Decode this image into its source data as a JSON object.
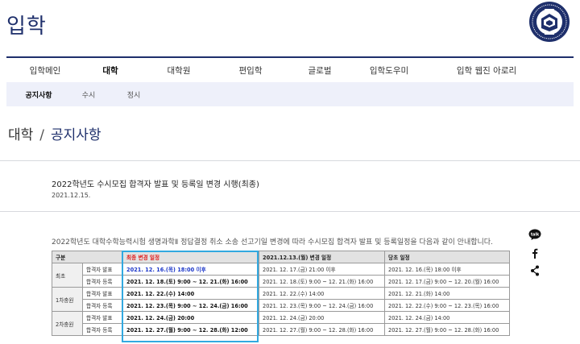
{
  "header": {
    "site_title": "입학",
    "logo_icon": "snu-emblem-icon"
  },
  "gnb": {
    "items": [
      "입학메인",
      "대학",
      "대학원",
      "편입학",
      "글로벌",
      "입학도우미",
      "입학 웹진 아로리"
    ],
    "active_index": 1
  },
  "lnb": {
    "items": [
      "공지사항",
      "수시",
      "정시"
    ],
    "active_index": 0
  },
  "breadcrumb": {
    "parent": "대학",
    "separator": "/",
    "current": "공지사항"
  },
  "post": {
    "title": "2022학년도 수시모집 합격자 발표 및 등록일 변경 시행(최종)",
    "date": "2021.12.15."
  },
  "intro": "2022학년도 대학수학능력시험 생명과학Ⅱ 정답결정 취소 소송 선고기일 변경에 따라 수시모집 합격자 발표 및 등록일정을 다음과 같이 안내합니다.",
  "share": {
    "icons": [
      "talk-icon",
      "facebook-icon",
      "share-icon"
    ],
    "talk_label": "talk"
  },
  "table": {
    "headers": [
      "구분",
      "최종 변경 일정",
      "2021.12.13.(월) 변경 일정",
      "당초 일정"
    ],
    "groups": [
      {
        "label": "최초",
        "rows": [
          {
            "sub": "합격자 발표",
            "final": "2021. 12. 16.(목) 18:00 이후",
            "mid": "2021. 12. 17.(금) 21:00 이후",
            "orig": "2021. 12. 16.(목) 18:00 이후"
          },
          {
            "sub": "합격자 등록",
            "final": "2021. 12. 18.(토) 9:00 ~ 12. 21.(화) 16:00",
            "mid": "2021. 12. 18.(토) 9:00 ~ 12. 21.(화) 16:00",
            "orig": "2021. 12. 17.(금) 9:00 ~ 12. 20.(월) 16:00"
          }
        ]
      },
      {
        "label": "1차충원",
        "rows": [
          {
            "sub": "합격자 발표",
            "final": "2021. 12. 22.(수) 14:00",
            "mid": "2021. 12. 22.(수) 14:00",
            "orig": "2021. 12. 21.(화) 14:00"
          },
          {
            "sub": "합격자 등록",
            "final": "2021. 12. 23.(목) 9:00 ~ 12. 24.(금) 16:00",
            "mid": "2021. 12. 23.(목) 9:00 ~ 12. 24.(금) 16:00",
            "orig": "2021. 12. 22.(수) 9:00 ~ 12. 23.(목) 16:00"
          }
        ]
      },
      {
        "label": "2차충원",
        "rows": [
          {
            "sub": "합격자 발표",
            "final": "2021. 12. 24.(금) 20:00",
            "mid": "2021. 12. 24.(금) 20:00",
            "orig": "2021. 12. 24.(금) 14:00"
          },
          {
            "sub": "합격자 등록",
            "final": "2021. 12. 27.(월) 9:00 ~ 12. 28.(화) 12:00",
            "mid": "2021. 12. 27.(월) 9:00 ~ 12. 28.(화) 16:00",
            "orig": "2021. 12. 27.(월) 9:00 ~ 12. 28.(화) 16:00"
          }
        ]
      }
    ]
  },
  "colors": {
    "brand_navy": "#1e2f6b",
    "final_header_red": "#e01e1e",
    "final_first_blue": "#1c37c9",
    "highlight_box": "#32a9e0",
    "lnb_bg": "#eef0fa"
  }
}
